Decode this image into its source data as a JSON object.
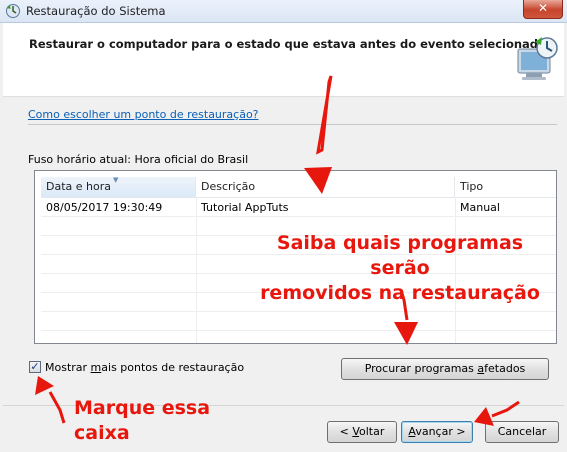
{
  "window": {
    "title": "Restauração do Sistema",
    "close_glyph": "✕"
  },
  "header": {
    "title": "Restaurar o computador para o estado que estava antes do evento selecionado",
    "icon": "system-restore-icon"
  },
  "link_restore_point": "Como escolher um ponto de restauração?",
  "timezone_text": "Fuso horário atual: Hora oficial do Brasil",
  "table": {
    "columns": [
      "Data e hora",
      "Descrição",
      "Tipo"
    ],
    "rows": [
      {
        "date": "08/05/2017 19:30:49",
        "description": "Tutorial AppTuts",
        "type": "Manual"
      }
    ]
  },
  "checkbox": {
    "checked": true,
    "label_pre": "Mostrar ",
    "label_underline": "m",
    "label_post": "ais pontos de restauração"
  },
  "buttons": {
    "scan": {
      "pre": "Procurar programas ",
      "underline": "a",
      "post": "fetados"
    },
    "back": {
      "pre": "< ",
      "underline": "V",
      "post": "oltar"
    },
    "next": {
      "pre": "",
      "underline": "A",
      "post": "vançar >"
    },
    "cancel": "Cancelar"
  },
  "annotations": {
    "line1": "Saiba quais programas serão",
    "line2": "removidos na restauração",
    "checkbox_note": "Marque essa caixa",
    "color": "#e8170e"
  }
}
